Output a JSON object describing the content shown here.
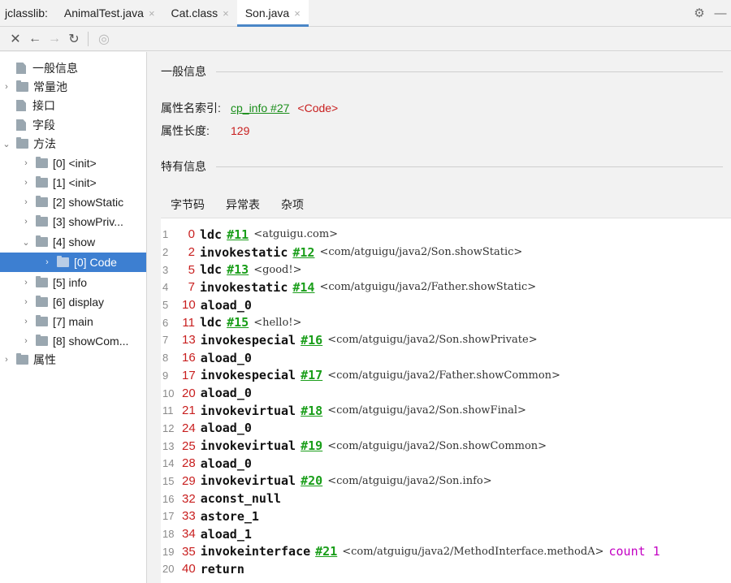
{
  "tabbar": {
    "app_label": "jclasslib:",
    "tabs": [
      {
        "label": "AnimalTest.java",
        "close": "×"
      },
      {
        "label": "Cat.class",
        "close": "×"
      },
      {
        "label": "Son.java",
        "close": "×"
      }
    ],
    "active_tab": 2,
    "settings_glyph": "⚙",
    "minimize_glyph": "—"
  },
  "toolbar": {
    "close_glyph": "✕",
    "back_glyph": "←",
    "forward_glyph": "→",
    "reload_glyph": "↻",
    "browser_glyph": "◎"
  },
  "tree": [
    {
      "label": "一般信息",
      "arrow": "",
      "icon": "file",
      "depth": 1
    },
    {
      "label": "常量池",
      "arrow": "›",
      "icon": "folder",
      "depth": 0
    },
    {
      "label": "接口",
      "arrow": "",
      "icon": "file",
      "depth": 1
    },
    {
      "label": "字段",
      "arrow": "",
      "icon": "file",
      "depth": 1
    },
    {
      "label": "方法",
      "arrow": "⌄",
      "icon": "folder",
      "depth": 0
    },
    {
      "label": "[0] <init>",
      "arrow": "›",
      "icon": "folder",
      "depth": 1
    },
    {
      "label": "[1] <init>",
      "arrow": "›",
      "icon": "folder",
      "depth": 1
    },
    {
      "label": "[2] showStatic",
      "arrow": "›",
      "icon": "folder",
      "depth": 1
    },
    {
      "label": "[3] showPriv...",
      "arrow": "›",
      "icon": "folder",
      "depth": 1
    },
    {
      "label": "[4] show",
      "arrow": "⌄",
      "icon": "folder",
      "depth": 1
    },
    {
      "label": "[0] Code",
      "arrow": "›",
      "icon": "folder",
      "depth": 2,
      "selected": true
    },
    {
      "label": "[5] info",
      "arrow": "›",
      "icon": "folder",
      "depth": 1
    },
    {
      "label": "[6] display",
      "arrow": "›",
      "icon": "folder",
      "depth": 1
    },
    {
      "label": "[7] main",
      "arrow": "›",
      "icon": "folder",
      "depth": 1
    },
    {
      "label": "[8] showCom...",
      "arrow": "›",
      "icon": "folder",
      "depth": 1
    },
    {
      "label": "属性",
      "arrow": "›",
      "icon": "folder",
      "depth": 0
    }
  ],
  "general": {
    "section_title": "一般信息",
    "name_index_label": "属性名索引:",
    "name_index_link": "cp_info #27",
    "name_index_value": "<Code>",
    "length_label": "属性长度:",
    "length_value": "129"
  },
  "specific": {
    "section_title": "特有信息",
    "subtabs": [
      "字节码",
      "异常表",
      "杂项"
    ],
    "active_subtab": 0
  },
  "bytecode": [
    {
      "line": "1",
      "offset": "0",
      "op": "ldc",
      "ref": "#11",
      "comment": "<atguigu.com>"
    },
    {
      "line": "2",
      "offset": "2",
      "op": "invokestatic",
      "ref": "#12",
      "comment": "<com/atguigu/java2/Son.showStatic>"
    },
    {
      "line": "3",
      "offset": "5",
      "op": "ldc",
      "ref": "#13",
      "comment": "<good!>"
    },
    {
      "line": "4",
      "offset": "7",
      "op": "invokestatic",
      "ref": "#14",
      "comment": "<com/atguigu/java2/Father.showStatic>"
    },
    {
      "line": "5",
      "offset": "10",
      "op": "aload_0",
      "ref": "",
      "comment": ""
    },
    {
      "line": "6",
      "offset": "11",
      "op": "ldc",
      "ref": "#15",
      "comment": "<hello!>"
    },
    {
      "line": "7",
      "offset": "13",
      "op": "invokespecial",
      "ref": "#16",
      "comment": "<com/atguigu/java2/Son.showPrivate>"
    },
    {
      "line": "8",
      "offset": "16",
      "op": "aload_0",
      "ref": "",
      "comment": ""
    },
    {
      "line": "9",
      "offset": "17",
      "op": "invokespecial",
      "ref": "#17",
      "comment": "<com/atguigu/java2/Father.showCommon>"
    },
    {
      "line": "10",
      "offset": "20",
      "op": "aload_0",
      "ref": "",
      "comment": ""
    },
    {
      "line": "11",
      "offset": "21",
      "op": "invokevirtual",
      "ref": "#18",
      "comment": "<com/atguigu/java2/Son.showFinal>"
    },
    {
      "line": "12",
      "offset": "24",
      "op": "aload_0",
      "ref": "",
      "comment": ""
    },
    {
      "line": "13",
      "offset": "25",
      "op": "invokevirtual",
      "ref": "#19",
      "comment": "<com/atguigu/java2/Son.showCommon>"
    },
    {
      "line": "14",
      "offset": "28",
      "op": "aload_0",
      "ref": "",
      "comment": ""
    },
    {
      "line": "15",
      "offset": "29",
      "op": "invokevirtual",
      "ref": "#20",
      "comment": "<com/atguigu/java2/Son.info>"
    },
    {
      "line": "16",
      "offset": "32",
      "op": "aconst_null",
      "ref": "",
      "comment": ""
    },
    {
      "line": "17",
      "offset": "33",
      "op": "astore_1",
      "ref": "",
      "comment": ""
    },
    {
      "line": "18",
      "offset": "34",
      "op": "aload_1",
      "ref": "",
      "comment": ""
    },
    {
      "line": "19",
      "offset": "35",
      "op": "invokeinterface",
      "ref": "#21",
      "comment": "<com/atguigu/java2/MethodInterface.methodA>",
      "extra": "count 1"
    },
    {
      "line": "20",
      "offset": "40",
      "op": "return",
      "ref": "",
      "comment": ""
    }
  ]
}
